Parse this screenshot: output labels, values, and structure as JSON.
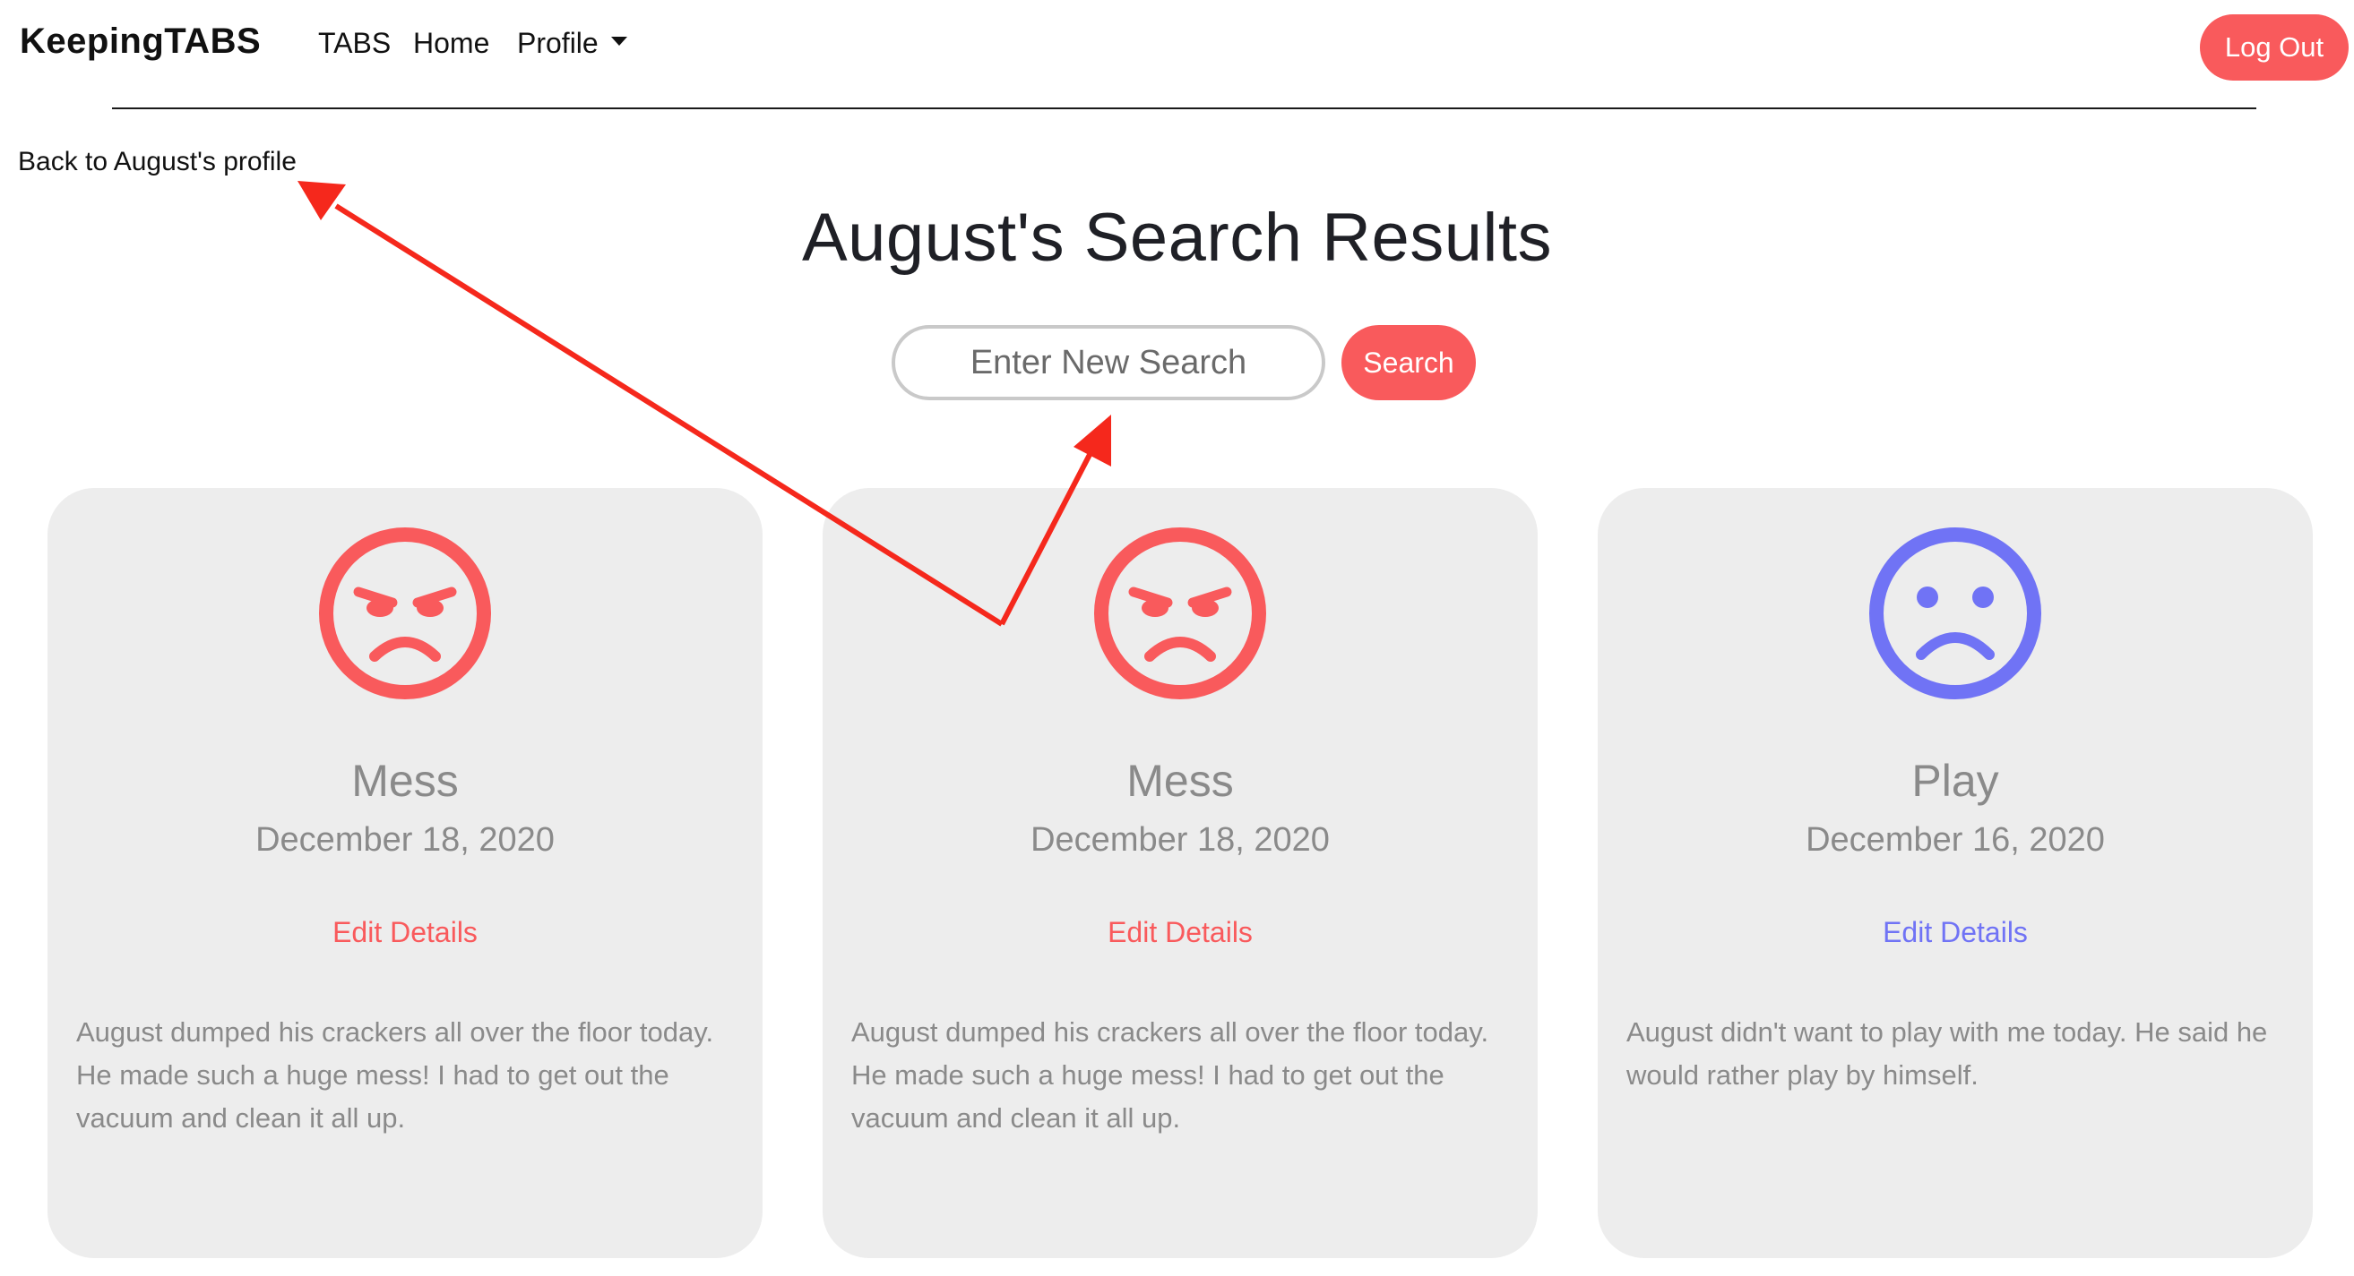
{
  "navbar": {
    "brand": "KeepingTABS",
    "links": [
      {
        "label": "TABS"
      },
      {
        "label": "Home"
      },
      {
        "label": "Profile"
      }
    ],
    "logout_label": "Log Out"
  },
  "back_link": "Back to August's profile",
  "page_title": "August's Search Results",
  "search": {
    "placeholder": "Enter New Search",
    "button_label": "Search"
  },
  "cards": [
    {
      "title": "Mess",
      "date": "December 18, 2020",
      "edit_label": "Edit Details",
      "description": "August dumped his crackers all over the floor today. He made such a huge mess! I had to get out the vacuum and clean it all up.",
      "icon": "angry-face-icon",
      "color": "#f95a5c"
    },
    {
      "title": "Mess",
      "date": "December 18, 2020",
      "edit_label": "Edit Details",
      "description": "August dumped his crackers all over the floor today. He made such a huge mess! I had to get out the vacuum and clean it all up.",
      "icon": "angry-face-icon",
      "color": "#f95a5c"
    },
    {
      "title": "Play",
      "date": "December 16, 2020",
      "edit_label": "Edit Details",
      "description": "August didn't want to play with me today. He said he would rather play by himself.",
      "icon": "sad-face-icon",
      "color": "#7073f5"
    }
  ],
  "colors": {
    "accent": "#f95a5c",
    "play": "#7073f5",
    "card_background": "#ededed",
    "annotation_arrow": "#f5281c"
  }
}
